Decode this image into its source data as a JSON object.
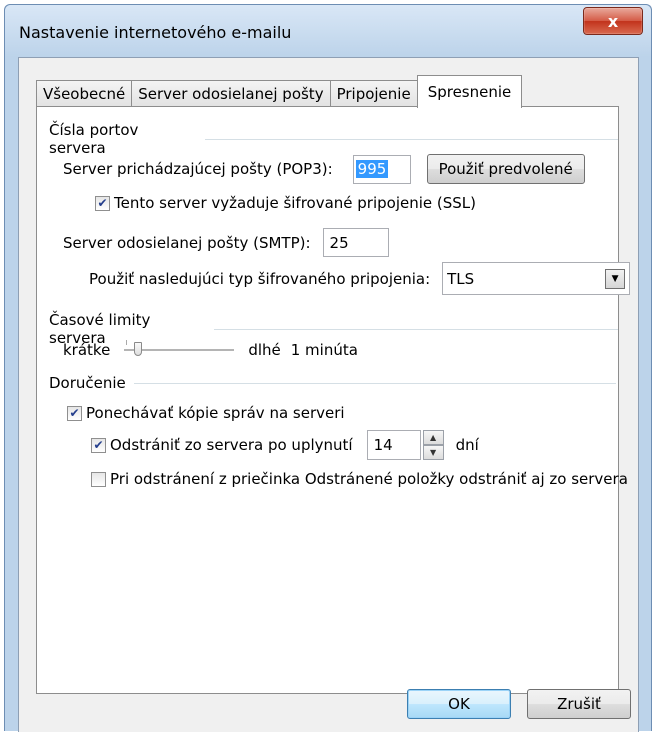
{
  "window": {
    "title": "Nastavenie internetového e-mailu",
    "close_label": "x"
  },
  "tabs": [
    {
      "label": "Všeobecné"
    },
    {
      "label": "Server odosielanej pošty"
    },
    {
      "label": "Pripojenie"
    },
    {
      "label": "Spresnenie"
    }
  ],
  "ports": {
    "section_title": "Čísla portov servera",
    "incoming_label": "Server prichádzajúcej pošty (POP3):",
    "incoming_value": "995",
    "default_button": "Použiť predvolené",
    "ssl_label": "Tento server vyžaduje šifrované pripojenie (SSL)",
    "ssl_checked": true,
    "outgoing_label": "Server odosielanej pošty (SMTP):",
    "outgoing_value": "25",
    "encryption_label": "Použiť nasledujúci typ šifrovaného pripojenia:",
    "encryption_value": "TLS"
  },
  "timeouts": {
    "section_title": "Časové limity servera",
    "short_label": "krátke",
    "long_label": "dlhé",
    "value_label": "1 minúta",
    "slider_fraction": 0.1
  },
  "delivery": {
    "section_title": "Doručenie",
    "keep_copy_label": "Ponechávať kópie správ na serveri",
    "keep_copy_checked": true,
    "remove_after_label": "Odstrániť zo servera po uplynutí",
    "remove_after_checked": true,
    "days_value": "14",
    "days_unit": "dní",
    "remove_deleted_label": "Pri odstránení z priečinka Odstránené položky odstrániť aj zo servera",
    "remove_deleted_checked": false
  },
  "footer": {
    "ok_label": "OK",
    "cancel_label": "Zrušiť"
  },
  "icons": {
    "check": "checkmark-icon",
    "dropdown": "chevron-down-icon",
    "spin_up": "arrow-up-icon",
    "spin_down": "arrow-down-icon"
  }
}
